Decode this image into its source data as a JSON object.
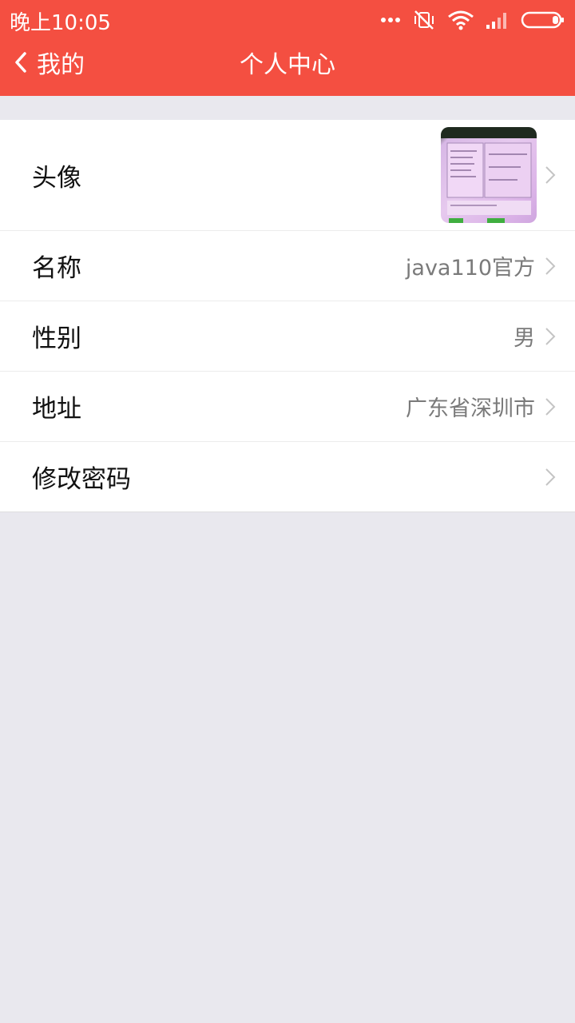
{
  "status_bar": {
    "time": "晚上10:05"
  },
  "nav": {
    "back_label": "我的",
    "title": "个人中心"
  },
  "profile": {
    "rows": [
      {
        "label": "头像",
        "value": ""
      },
      {
        "label": "名称",
        "value": "java110官方"
      },
      {
        "label": "性别",
        "value": "男"
      },
      {
        "label": "地址",
        "value": "广东省深圳市"
      },
      {
        "label": "修改密码",
        "value": ""
      }
    ]
  },
  "colors": {
    "header": "#f44f41",
    "background": "#e9e8ee",
    "row_background": "#ffffff"
  }
}
